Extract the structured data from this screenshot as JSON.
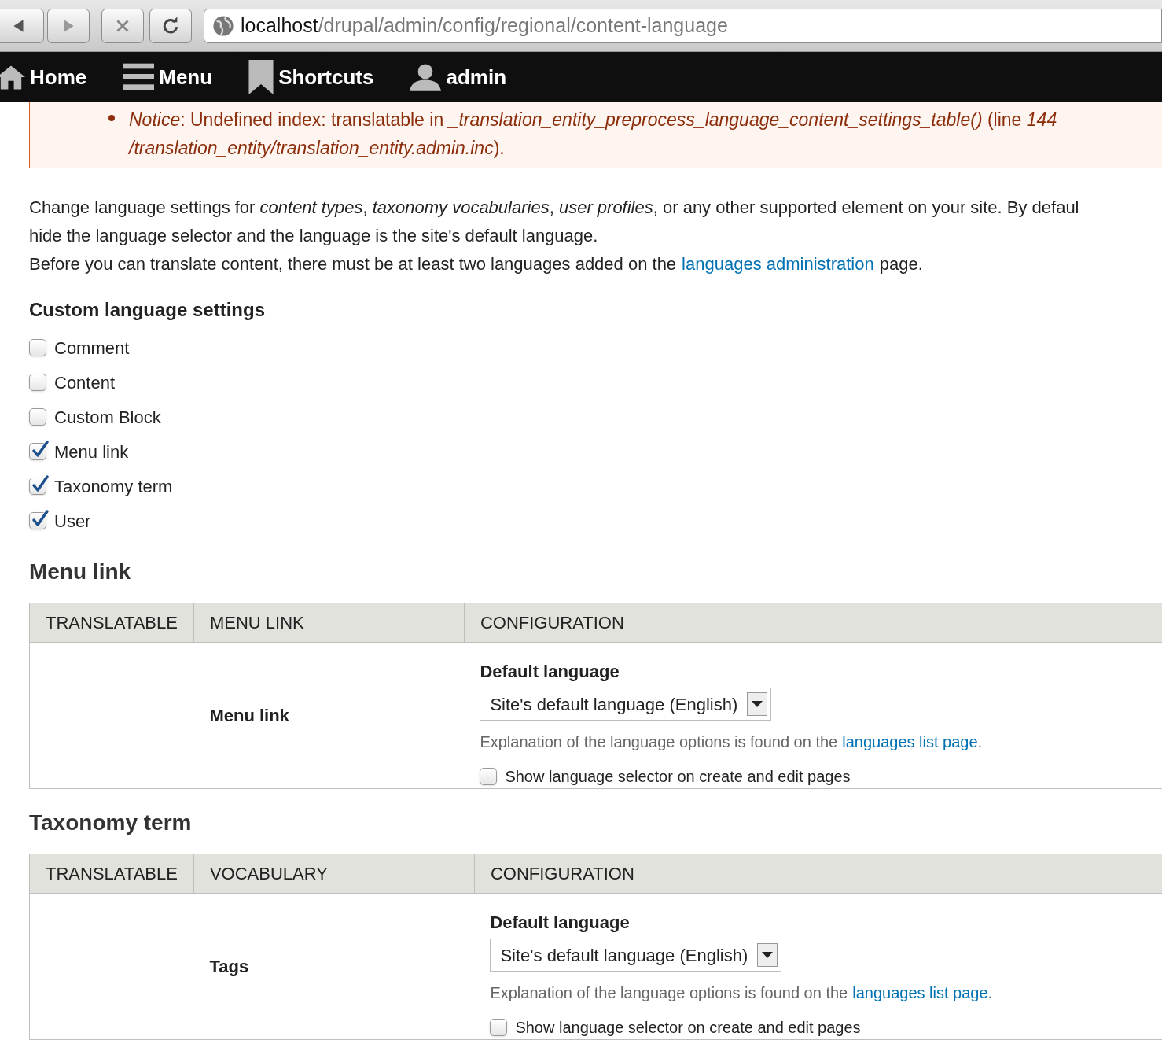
{
  "browser": {
    "url_host": "localhost",
    "url_path": "/drupal/admin/config/regional/content-language"
  },
  "toolbar": {
    "items": [
      {
        "kind": "home",
        "label": "Home"
      },
      {
        "kind": "menu",
        "label": "Menu"
      },
      {
        "kind": "shortcuts",
        "label": "Shortcuts"
      },
      {
        "kind": "user",
        "label": "admin"
      }
    ]
  },
  "notice": {
    "lines": [
      "*Notice*: Undefined index: translatable in *_translation_entity_preprocess_language_content_settings_table()* (line *144*",
      "*/translation_entity/translation_entity.admin.inc*)."
    ]
  },
  "intro": {
    "lines": [
      "Change language settings for *content types*, *taxonomy vocabularies*, *user profiles*, or any other supported element on your site. By defaul",
      "hide the language selector and the language is the site's default language."
    ],
    "note_before": "Before you can translate content, there must be at least two languages added on the",
    "note_link": "languages administration",
    "note_after": "page."
  },
  "custom_settings": {
    "title": "Custom language settings",
    "items": [
      {
        "label": "Comment",
        "checked": false
      },
      {
        "label": "Content",
        "checked": false
      },
      {
        "label": "Custom Block",
        "checked": false
      },
      {
        "label": "Menu link",
        "checked": true
      },
      {
        "label": "Taxonomy term",
        "checked": true
      },
      {
        "label": "User",
        "checked": true
      }
    ]
  },
  "sections": [
    {
      "title": "Menu link",
      "columns": [
        "TRANSLATABLE",
        "MENU LINK",
        "CONFIGURATION"
      ],
      "row": {
        "name": "Menu link",
        "default_language_label": "Default language",
        "select_value": "Site's default language (English)",
        "explanation": "Explanation of the language options is found on the",
        "explanation_link": "languages list page",
        "explanation_end": ".",
        "selector_label": "Show language selector on create and edit pages",
        "selector_checked": false
      }
    },
    {
      "title": "Taxonomy term",
      "columns": [
        "TRANSLATABLE",
        "VOCABULARY",
        "CONFIGURATION"
      ],
      "row": {
        "name": "Tags",
        "default_language_label": "Default language",
        "select_value": "Site's default language (English)",
        "explanation": "Explanation of the language options is found on the",
        "explanation_link": "languages list page",
        "explanation_end": ".",
        "selector_label": "Show language selector on create and edit pages",
        "selector_checked": false
      }
    }
  ]
}
